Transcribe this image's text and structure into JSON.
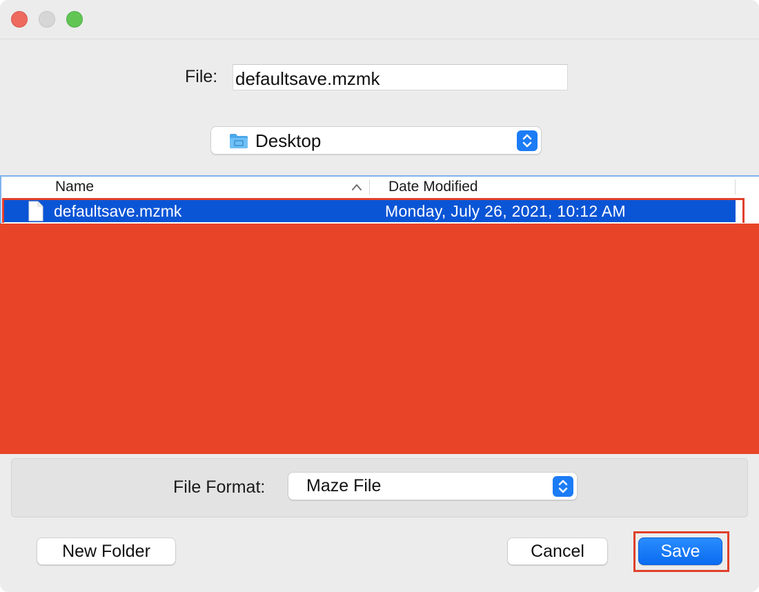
{
  "file": {
    "label": "File:",
    "value": "defaultsave.mzmk"
  },
  "location": {
    "selected": "Desktop",
    "icon": "folder-icon"
  },
  "list": {
    "columns": [
      {
        "label": "Name",
        "sort": "ascending"
      },
      {
        "label": "Date Modified"
      }
    ],
    "rows": [
      {
        "name": "defaultsave.mzmk",
        "date": "Monday, July 26, 2021, 10:12 AM",
        "selected": true,
        "icon": "document-icon"
      }
    ]
  },
  "format": {
    "label": "File Format:",
    "selected": "Maze File"
  },
  "buttons": {
    "new_folder": "New Folder",
    "cancel": "Cancel",
    "save": "Save"
  },
  "colors": {
    "accent": "#0a6cf0",
    "selection": "#0a55d6",
    "highlight_outline": "#e0402b",
    "redaction": "#e84427"
  }
}
